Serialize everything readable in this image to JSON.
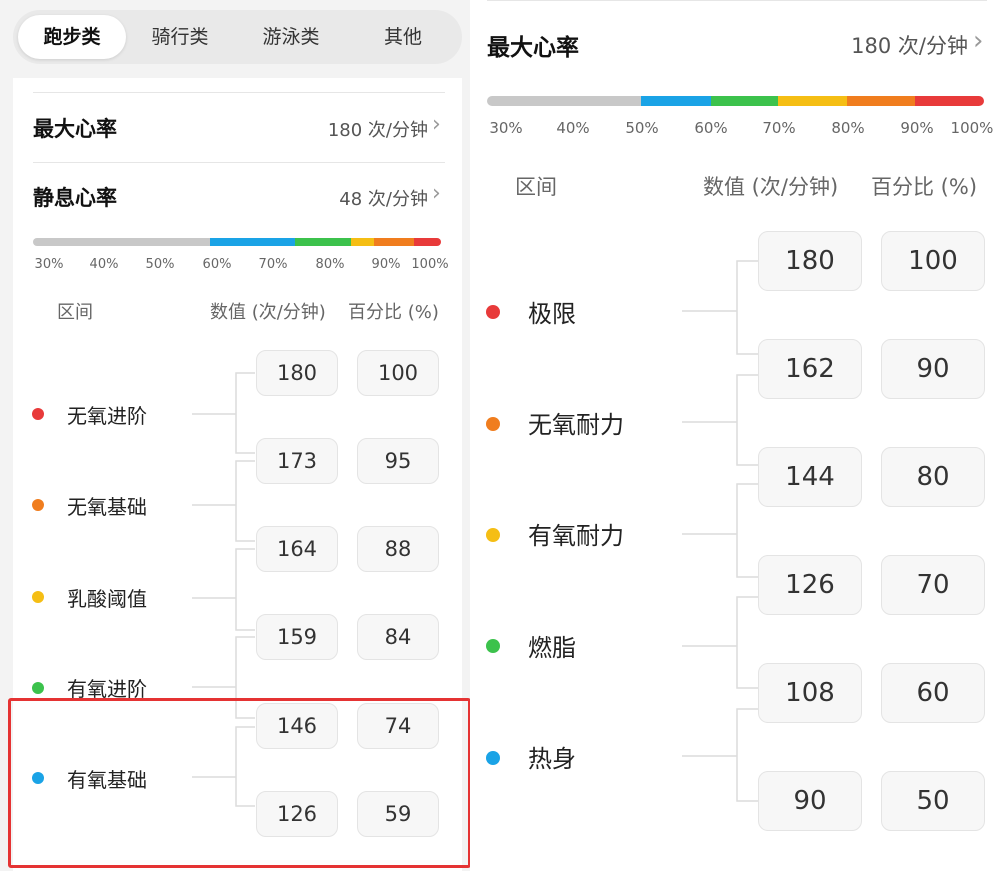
{
  "tabs": [
    {
      "label": "跑步类",
      "active": true
    },
    {
      "label": "骑行类",
      "active": false
    },
    {
      "label": "游泳类",
      "active": false
    },
    {
      "label": "其他",
      "active": false
    }
  ],
  "left": {
    "max_hr_label": "最大心率",
    "max_hr_value": "180 次/分钟",
    "rest_hr_label": "静息心率",
    "rest_hr_value": "48 次/分钟",
    "ticks": [
      "30%",
      "40%",
      "50%",
      "60%",
      "70%",
      "80%",
      "90%",
      "100%"
    ],
    "header_zone": "区间",
    "header_value": "数值 (次/分钟)",
    "header_pct": "百分比 (%)",
    "zones": [
      {
        "name": "无氧进阶",
        "color": "#e83a3a"
      },
      {
        "name": "无氧基础",
        "color": "#f07d1e"
      },
      {
        "name": "乳酸阈值",
        "color": "#f5be14"
      },
      {
        "name": "有氧进阶",
        "color": "#3cc24c"
      },
      {
        "name": "有氧基础",
        "color": "#1aa3e6"
      }
    ],
    "values": [
      {
        "bpm": "180",
        "pct": "100"
      },
      {
        "bpm": "173",
        "pct": "95"
      },
      {
        "bpm": "164",
        "pct": "88"
      },
      {
        "bpm": "159",
        "pct": "84"
      },
      {
        "bpm": "146",
        "pct": "74"
      },
      {
        "bpm": "126",
        "pct": "59"
      }
    ]
  },
  "right": {
    "max_hr_label": "最大心率",
    "max_hr_value": "180 次/分钟",
    "ticks": [
      "30%",
      "40%",
      "50%",
      "60%",
      "70%",
      "80%",
      "90%",
      "100%"
    ],
    "header_zone": "区间",
    "header_value": "数值 (次/分钟)",
    "header_pct": "百分比 (%)",
    "zones": [
      {
        "name": "极限",
        "color": "#e83a3a"
      },
      {
        "name": "无氧耐力",
        "color": "#f07d1e"
      },
      {
        "name": "有氧耐力",
        "color": "#f5be14"
      },
      {
        "name": "燃脂",
        "color": "#3cc24c"
      },
      {
        "name": "热身",
        "color": "#1aa3e6"
      }
    ],
    "values": [
      {
        "bpm": "180",
        "pct": "100"
      },
      {
        "bpm": "162",
        "pct": "90"
      },
      {
        "bpm": "144",
        "pct": "80"
      },
      {
        "bpm": "126",
        "pct": "70"
      },
      {
        "bpm": "108",
        "pct": "60"
      },
      {
        "bpm": "90",
        "pct": "50"
      }
    ]
  },
  "colors": {
    "gray": "#c8c8c8",
    "blue": "#1aa3e6",
    "green": "#3cc24c",
    "yellow": "#f5be14",
    "orange": "#f07d1e",
    "red": "#e83a3a",
    "highlight": "#e53333"
  }
}
